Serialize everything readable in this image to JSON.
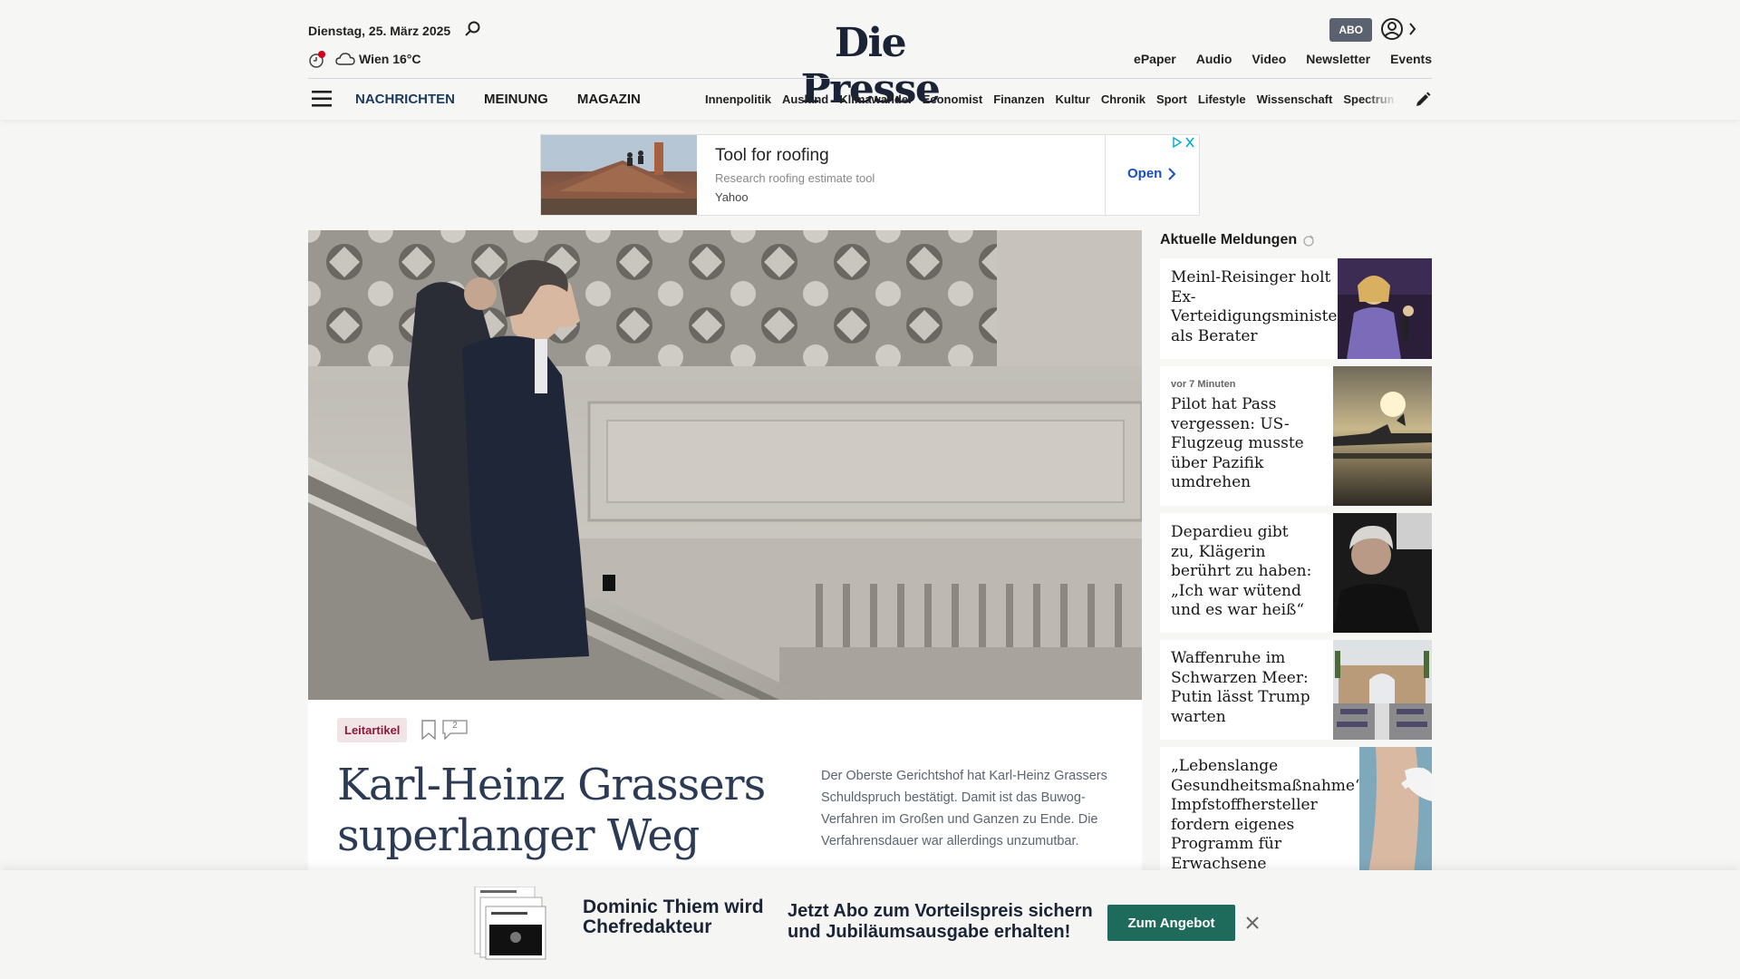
{
  "header": {
    "date": "Dienstag, 25. März 2025",
    "weather": "Wien 16°C",
    "logo": "Die Presse",
    "abo_label": "ABO",
    "top_links": [
      "ePaper",
      "Audio",
      "Video",
      "Newsletter",
      "Events"
    ],
    "main_nav": [
      "NACHRICHTEN",
      "MEINUNG",
      "MAGAZIN"
    ],
    "sub_nav": [
      "Innenpolitik",
      "Ausland",
      "Klimawandel",
      "Economist",
      "Finanzen",
      "Kultur",
      "Chronik",
      "Sport",
      "Lifestyle",
      "Wissenschaft",
      "Spectrum"
    ]
  },
  "ad": {
    "title": "Tool for roofing",
    "subtitle": "Research roofing estimate tool",
    "source": "Yahoo",
    "cta": "Open"
  },
  "lead": {
    "tag": "Leitartikel",
    "comment_count": "2",
    "headline": "Karl-Heinz Grassers superlanger Weg",
    "teaser": "Der Oberste Gerichtshof hat Karl-Heinz Grassers Schuldspruch bestätigt. Damit ist das Buwog-Verfahren im Großen und Ganzen zu Ende. Die Verfahrensdauer war allerdings unzumutbar."
  },
  "sidebar": {
    "title": "Aktuelle Meldungen",
    "items": [
      {
        "time": "",
        "headline": "Meinl-Reisinger holt Ex-Verteidigungsminister als Berater"
      },
      {
        "time": "vor 7 Minuten",
        "headline": "Pilot hat Pass vergessen: US-Flugzeug musste über Pazifik umdrehen"
      },
      {
        "time": "",
        "headline": "Depardieu gibt zu, Klägerin berührt zu haben: „Ich war wütend und es war heiß“"
      },
      {
        "time": "",
        "headline": "Waffenruhe im Schwarzen Meer: Putin lässt Trump warten"
      },
      {
        "time": "",
        "headline": "„Lebenslange Gesundheitsmaßnahme“: Impfstoffhersteller fordern eigenes Programm für Erwachsene"
      }
    ]
  },
  "promo": {
    "heading": "Dominic Thiem wird Chefredakteur",
    "text": "Jetzt Abo zum Vorteilspreis sichern und Jubiläumsausgabe erhalten!",
    "button": "Zum Angebot"
  },
  "colors": {
    "accent": "#1c3a5e",
    "tag_bg": "#f1e4e6",
    "tag_fg": "#8b1a38",
    "cta": "#1e6b5b"
  }
}
